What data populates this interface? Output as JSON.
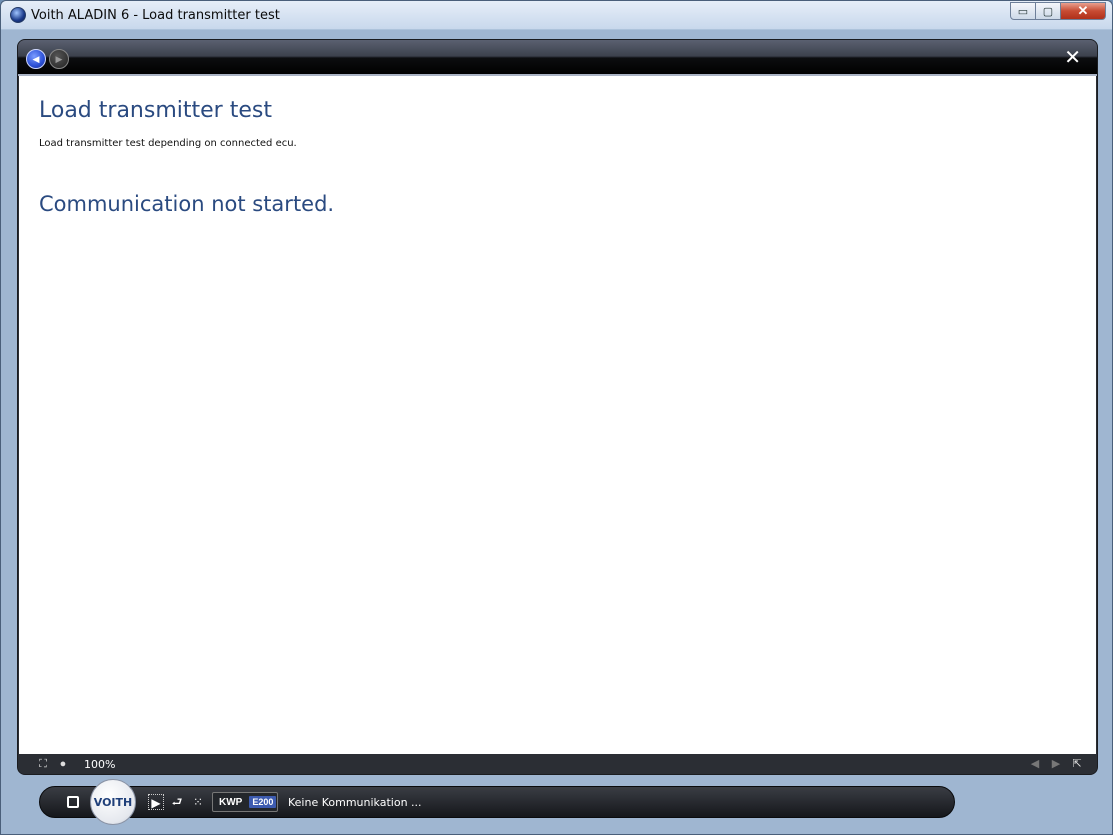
{
  "window": {
    "title": "Voith ALADIN 6 - Load transmitter test",
    "minimize_label": "▭",
    "maximize_label": "▢",
    "close_label": "✕"
  },
  "content": {
    "heading": "Load transmitter test",
    "description": "Load transmitter test depending on connected ecu.",
    "status_message": "Communication not started."
  },
  "viewer": {
    "zoom": "100%"
  },
  "taskbar": {
    "logo_text": "VOITH",
    "protocol": "KWP",
    "ecu": "E200",
    "connection_status": "Keine Kommunikation ..."
  },
  "colors": {
    "heading": "#2a4a80",
    "accent": "#3d5bb0"
  }
}
